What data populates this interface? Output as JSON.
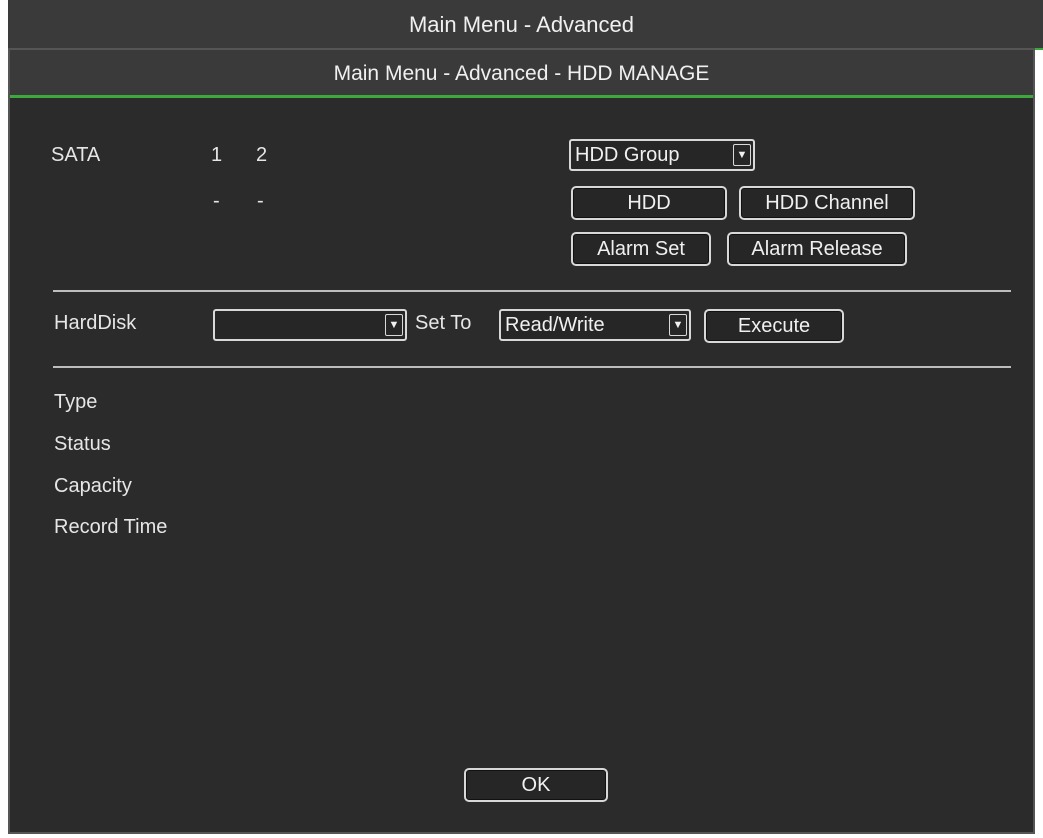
{
  "outer_title": "Main Menu - Advanced",
  "dialog_title": "Main Menu - Advanced - HDD MANAGE",
  "sata": {
    "label": "SATA",
    "ports": [
      "1",
      "2"
    ],
    "port_states": [
      "-",
      "-"
    ]
  },
  "hdd_group_select": {
    "value": "HDD Group"
  },
  "buttons": {
    "hdd": "HDD",
    "hdd_channel": "HDD Channel",
    "alarm_set": "Alarm Set",
    "alarm_release": "Alarm Release",
    "execute": "Execute",
    "ok": "OK"
  },
  "harddisk": {
    "label": "HardDisk",
    "value": "",
    "set_to_label": "Set To",
    "set_to_value": "Read/Write"
  },
  "info_labels": {
    "type": "Type",
    "status": "Status",
    "capacity": "Capacity",
    "record_time": "Record Time"
  },
  "colors": {
    "accent": "#3da93d",
    "background": "#2b2b2b",
    "header": "#3a3a3a"
  }
}
